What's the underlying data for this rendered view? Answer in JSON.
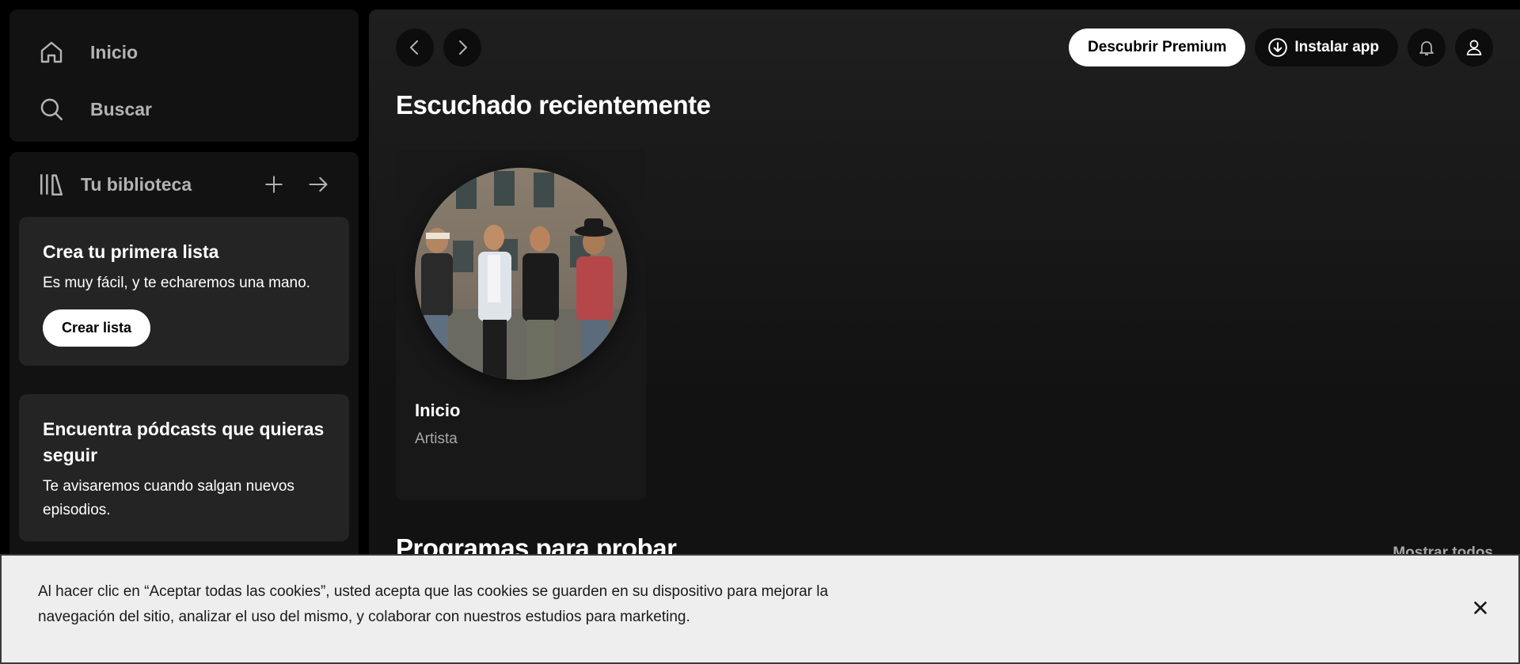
{
  "nav": {
    "home_label": "Inicio",
    "search_label": "Buscar"
  },
  "library": {
    "title": "Tu biblioteca",
    "promos": [
      {
        "title": "Crea tu primera lista",
        "text": "Es muy fácil, y te echaremos una mano.",
        "button": "Crear lista"
      },
      {
        "title": "Encuentra pódcasts que quieras seguir",
        "text": "Te avisaremos cuando salgan nuevos episodios."
      }
    ]
  },
  "topbar": {
    "premium_label": "Descubrir Premium",
    "install_label": "Instalar app"
  },
  "main": {
    "recent_title": "Escuchado recientemente",
    "card": {
      "title": "Inicio",
      "subtitle": "Artista"
    },
    "programs_title": "Programas para probar",
    "show_all": "Mostrar todos"
  },
  "cookie": {
    "text": "Al hacer clic en “Aceptar todas las cookies”, usted acepta que las cookies se guarden en su dispositivo para mejorar la navegación del sitio, analizar el uso del mismo, y colaborar con nuestros estudios para marketing."
  },
  "icons": {
    "home": "home-icon",
    "search": "search-icon",
    "library": "library-icon",
    "plus": "plus-icon",
    "arrow_right": "arrow-right-icon",
    "back": "chevron-left-icon",
    "forward": "chevron-right-icon",
    "download": "download-icon",
    "bell": "bell-icon",
    "user": "user-icon",
    "close": "close-icon"
  },
  "colors": {
    "background": "#000000",
    "panel": "#121212",
    "card": "#242424",
    "text_muted": "#b3b3b3",
    "cookie_bg": "#eeeeee"
  }
}
